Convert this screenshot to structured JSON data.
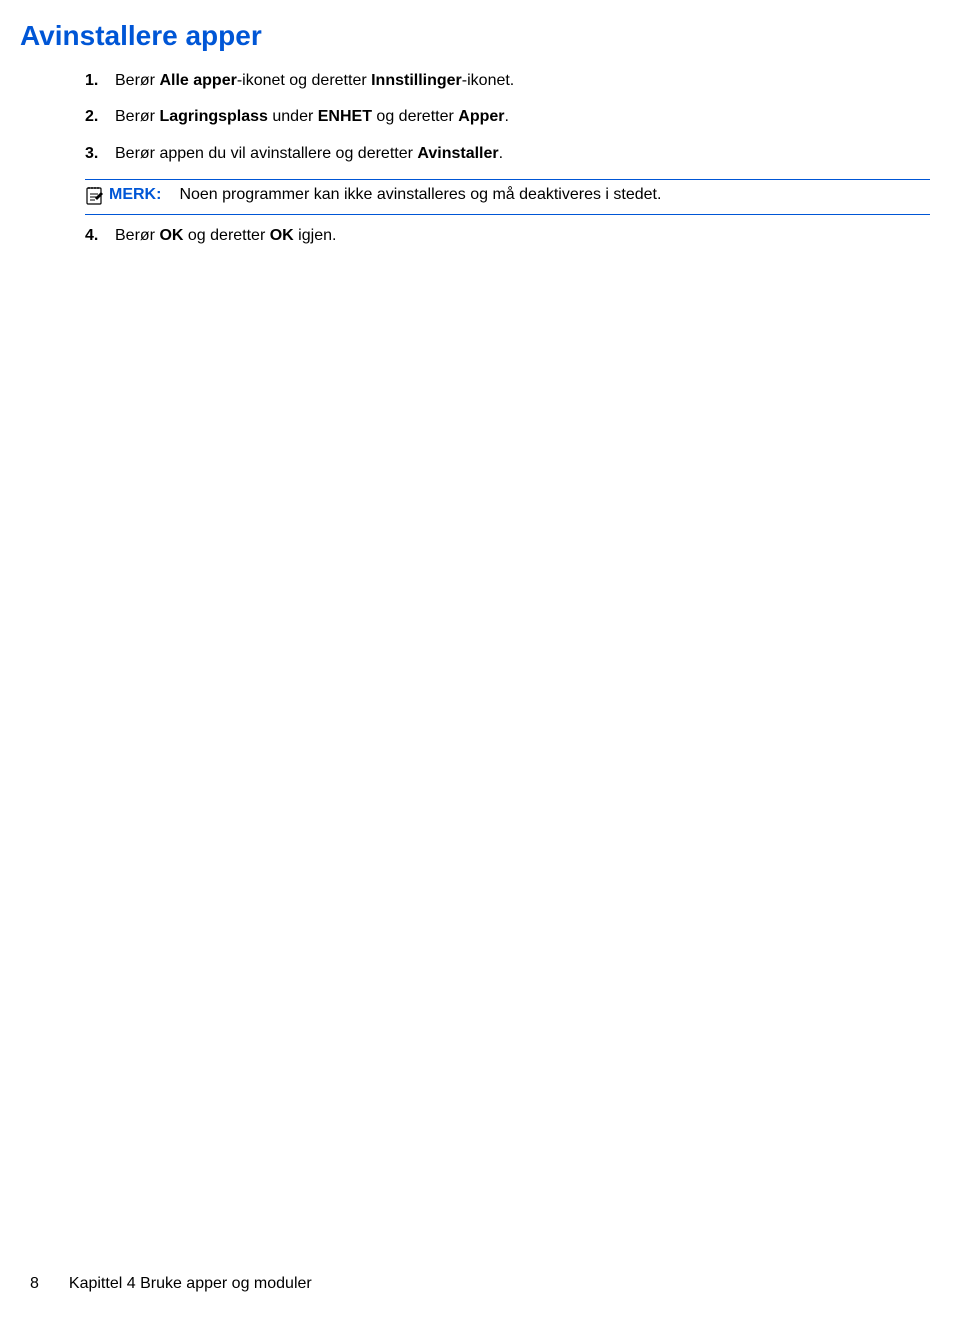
{
  "heading": "Avinstallere apper",
  "steps": [
    {
      "num": "1.",
      "parts": [
        {
          "text": "Berør ",
          "bold": false
        },
        {
          "text": "Alle apper",
          "bold": true
        },
        {
          "text": "-ikonet og deretter ",
          "bold": false
        },
        {
          "text": "Innstillinger",
          "bold": true
        },
        {
          "text": "-ikonet.",
          "bold": false
        }
      ]
    },
    {
      "num": "2.",
      "parts": [
        {
          "text": "Berør ",
          "bold": false
        },
        {
          "text": "Lagringsplass",
          "bold": true
        },
        {
          "text": " under ",
          "bold": false
        },
        {
          "text": "ENHET",
          "bold": true
        },
        {
          "text": " og deretter ",
          "bold": false
        },
        {
          "text": "Apper",
          "bold": true
        },
        {
          "text": ".",
          "bold": false
        }
      ]
    },
    {
      "num": "3.",
      "parts": [
        {
          "text": "Berør appen du vil avinstallere og deretter ",
          "bold": false
        },
        {
          "text": "Avinstaller",
          "bold": true
        },
        {
          "text": ".",
          "bold": false
        }
      ]
    }
  ],
  "note": {
    "label": "MERK:",
    "text": "Noen programmer kan ikke avinstalleres og må deaktiveres i stedet."
  },
  "step4": {
    "num": "4.",
    "parts": [
      {
        "text": "Berør ",
        "bold": false
      },
      {
        "text": "OK",
        "bold": true
      },
      {
        "text": " og deretter ",
        "bold": false
      },
      {
        "text": "OK",
        "bold": true
      },
      {
        "text": " igjen.",
        "bold": false
      }
    ]
  },
  "footer": {
    "pageNum": "8",
    "chapter": "Kapittel 4   Bruke apper og moduler"
  }
}
